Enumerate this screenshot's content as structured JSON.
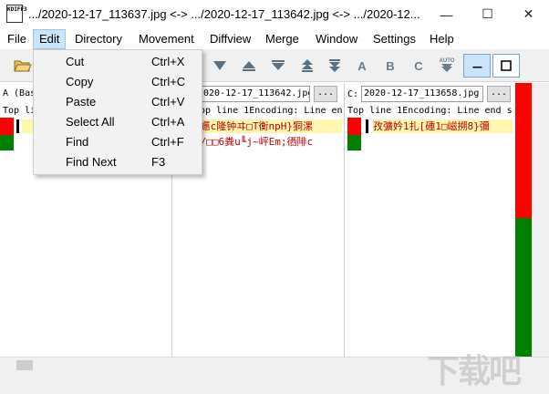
{
  "window": {
    "icon_text": "KDIFF3",
    "title": ".../2020-12-17_113637.jpg <-> .../2020-12-17_113642.jpg <-> .../2020-12...",
    "minimize": "—",
    "maximize": "☐",
    "close": "✕"
  },
  "menubar": {
    "items": [
      "File",
      "Edit",
      "Directory",
      "Movement",
      "Diffview",
      "Merge",
      "Window",
      "Settings",
      "Help"
    ]
  },
  "edit_menu": {
    "items": [
      {
        "label": "Cut",
        "shortcut": "Ctrl+X"
      },
      {
        "label": "Copy",
        "shortcut": "Ctrl+C"
      },
      {
        "label": "Paste",
        "shortcut": "Ctrl+V"
      },
      {
        "label": "Select All",
        "shortcut": "Ctrl+A"
      },
      {
        "label": "Find",
        "shortcut": "Ctrl+F"
      },
      {
        "label": "Find Next",
        "shortcut": "F3"
      }
    ]
  },
  "toolbar": {
    "letters": [
      "A",
      "B",
      "C"
    ],
    "auto": "AUTO",
    "line_btn": "---"
  },
  "panes": {
    "a": {
      "head": "A (Bas",
      "info": "Top li"
    },
    "b": {
      "path": "2020-12-17_113642.jpg",
      "browse": "...",
      "info": "Top line 1Encoding: Line end s",
      "line1": "0嬺c隆钟ヰ□T衡npH}狪漯",
      "line2": "s/□□6粪u╙j~岼Em;徆陫c"
    },
    "c": {
      "label": "C:",
      "path": "2020-12-17_113658.jpg",
      "browse": "...",
      "info": "Top line 1Encoding: Line end s",
      "line1": "孜彍妗1扎[硾1□嵫搠8}彌"
    }
  },
  "colors": {
    "diff_red": "#ff0000",
    "diff_green": "#008000",
    "diff_yellow": "#fff7ad",
    "diff_text_red": "#c00000",
    "menu_highlight": "#cce4f7"
  },
  "watermark": "下载吧"
}
